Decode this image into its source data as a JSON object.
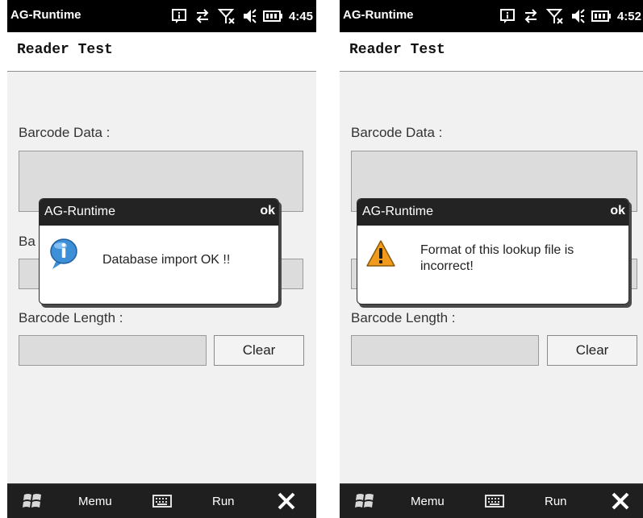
{
  "screens": [
    {
      "status": {
        "title": "AG-Runtime",
        "time": "4:45"
      },
      "app_title": "Reader Test",
      "labels": {
        "barcode_data": "Barcode Data :",
        "hidden_label": "Ba",
        "barcode_length": "Barcode Length :"
      },
      "clear_label": "Clear",
      "dialog": {
        "title": "AG-Runtime",
        "ok": "ok",
        "icon": "info-icon",
        "message_lines": [
          "Database import OK !!"
        ]
      },
      "taskbar": {
        "menu": "Memu",
        "run": "Run"
      }
    },
    {
      "status": {
        "title": "AG-Runtime",
        "time": "4:52"
      },
      "app_title": "Reader Test",
      "labels": {
        "barcode_data": "Barcode Data :",
        "hidden_label": "",
        "barcode_length": "Barcode Length :"
      },
      "clear_label": "Clear",
      "dialog": {
        "title": "AG-Runtime",
        "ok": "ok",
        "icon": "warning-icon",
        "message_lines": [
          "Format of this lookup file is",
          "incorrect!"
        ]
      },
      "taskbar": {
        "menu": "Memu",
        "run": "Run"
      }
    }
  ],
  "colors": {
    "warning": "#f29a1d",
    "info": "#3d8fd8",
    "taskbar": "#1f1f1f"
  }
}
